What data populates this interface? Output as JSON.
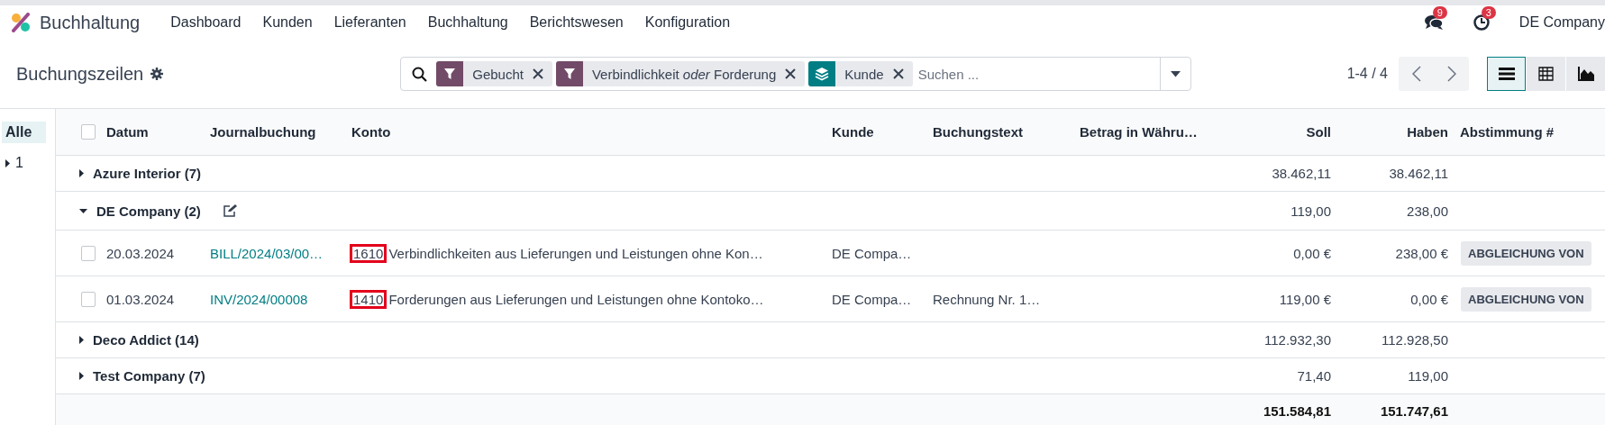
{
  "navbar": {
    "app_name": "Buchhaltung",
    "menu": [
      "Dashboard",
      "Kunden",
      "Lieferanten",
      "Buchhaltung",
      "Berichtswesen",
      "Konfiguration"
    ],
    "messages_badge": "9",
    "activities_badge": "3",
    "company": "DE Company"
  },
  "control_panel": {
    "title": "Buchungszeilen",
    "facets": [
      {
        "kind": "filter",
        "label": "Gebucht"
      },
      {
        "kind": "filter",
        "label": "Verbindlichkeit *oder* Forderung"
      },
      {
        "kind": "group_by",
        "label": "Kunde"
      }
    ],
    "search_placeholder": "Suchen ...",
    "pager": "1-4 / 4",
    "views": [
      {
        "kind": "list",
        "selected": true
      },
      {
        "kind": "pivot",
        "selected": false
      },
      {
        "kind": "graph",
        "selected": false
      }
    ]
  },
  "sidebar": {
    "items": [
      {
        "label": "Alle",
        "selected": true
      },
      {
        "label": "1",
        "selected": false,
        "expanded": false
      }
    ]
  },
  "table": {
    "columns": [
      {
        "kind": "text",
        "label": "Datum"
      },
      {
        "kind": "text",
        "label": "Journalbuchung"
      },
      {
        "kind": "text",
        "label": "Konto"
      },
      {
        "kind": "text",
        "label": "Kunde"
      },
      {
        "kind": "text",
        "label": "Buchungstext"
      },
      {
        "kind": "text",
        "label": "Betrag in Währu…"
      },
      {
        "kind": "amount",
        "label": "Soll"
      },
      {
        "kind": "amount",
        "label": "Haben"
      },
      {
        "kind": "text",
        "label": "Abstimmung #"
      }
    ],
    "all_selected": false,
    "groups": [
      {
        "label": "Azure Interior (7)",
        "expanded": false,
        "soll": "38.462,11",
        "haben": "38.462,11"
      },
      {
        "label": "DE Company (2)",
        "expanded": true,
        "edit_icon": true,
        "soll": "119,00",
        "haben": "238,00",
        "children": [
          {
            "selected": false,
            "date": "20.03.2024",
            "entry": "BILL/2024/03/00…",
            "account_code": "1610",
            "code_highlighted": true,
            "account_name": "Verbindlichkeiten aus Lieferungen und Leistungen ohne Kon…",
            "customer": "DE Compa…",
            "soll": "0,00 €",
            "haben": "238,00 €",
            "reconcile": "ABGLEICHUNG VON"
          },
          {
            "selected": false,
            "date": "01.03.2024",
            "entry": "INV/2024/00008",
            "account_code": "1410",
            "code_highlighted": true,
            "account_name": "Forderungen aus Lieferungen und Leistungen ohne Kontoko…",
            "customer": "DE Compa…",
            "text": "Rechnung Nr. 1…",
            "soll": "119,00 €",
            "haben": "0,00 €",
            "reconcile": "ABGLEICHUNG VON"
          }
        ]
      },
      {
        "label": "Deco Addict (14)",
        "expanded": false,
        "soll": "112.932,30",
        "haben": "112.928,50"
      },
      {
        "label": "Test Company (7)",
        "expanded": false,
        "soll": "71,40",
        "haben": "119,00"
      }
    ],
    "totals": {
      "soll": "151.584,81",
      "haben": "151.747,61"
    }
  }
}
